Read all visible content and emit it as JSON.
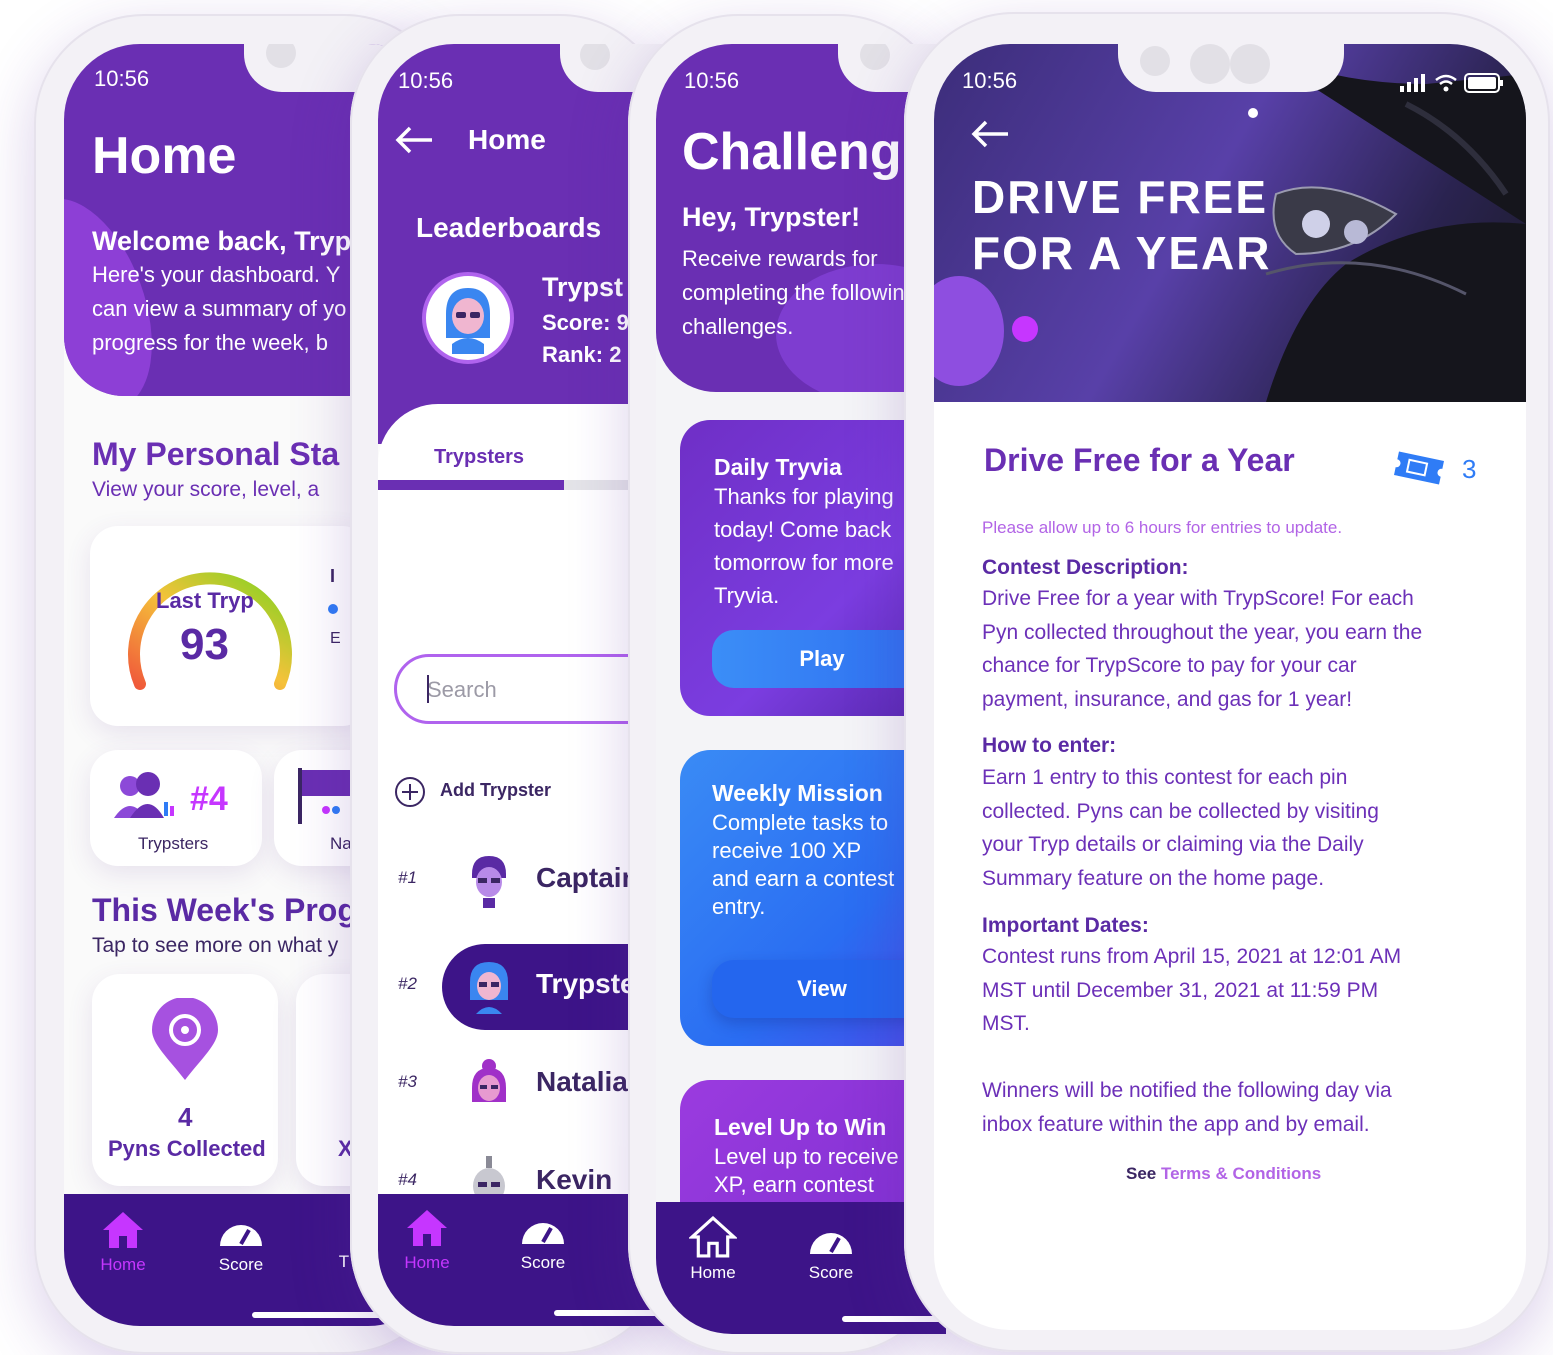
{
  "status": {
    "time": "10:56"
  },
  "home": {
    "title": "Home",
    "welcome": "Welcome back, Tryp",
    "intro_lines": [
      "Here's your dashboard. Y",
      "can view a summary of yo",
      "progress for the week, b"
    ],
    "stats_title": "My Personal Sta",
    "stats_sub": "View your score, level, a",
    "gauge": {
      "label": "Last Tryp",
      "value": "93"
    },
    "peek": [
      "I",
      "E"
    ],
    "rank_card": {
      "value": "#4",
      "label": "Trypsters"
    },
    "nat_card": {
      "label": "Na"
    },
    "progress_title": "This Week's Prog",
    "progress_sub": "Tap to see more on what y",
    "pyns": {
      "count": "4",
      "label": "Pyns Collected"
    },
    "peek_x": "X"
  },
  "leaderboard": {
    "nav_title": "Home",
    "title": "Leaderboards",
    "user": {
      "name": "Trypst",
      "score": "Score: 9",
      "rank": "Rank: 2"
    },
    "tab": "Trypsters",
    "search_placeholder": "Search",
    "add_label": "Add Trypster",
    "rows": [
      {
        "rank": "#1",
        "name": "Captain"
      },
      {
        "rank": "#2",
        "name": "Trypster"
      },
      {
        "rank": "#3",
        "name": "Natalia"
      },
      {
        "rank": "#4",
        "name": "Kevin"
      }
    ]
  },
  "challenges": {
    "title": "Challeng",
    "greeting": "Hey, Trypster!",
    "intro_lines": [
      "Receive rewards for",
      "completing the followin",
      "challenges."
    ],
    "cards": [
      {
        "title": "Daily Tryvia",
        "lines": [
          "Thanks for playing",
          "today! Come back",
          "tomorrow for more",
          "Tryvia."
        ],
        "button": "Play"
      },
      {
        "title": "Weekly Mission",
        "lines": [
          "Complete tasks to",
          "receive 100 XP",
          "and earn a contest",
          "entry."
        ],
        "button": "View"
      },
      {
        "title": "Level Up to Win",
        "lines": [
          "Level up to receive",
          "XP, earn contest"
        ]
      }
    ]
  },
  "tabs": {
    "home": "Home",
    "score": "Score",
    "peek": "T"
  },
  "contest": {
    "hero_line1": "DRIVE FREE",
    "hero_line2": "FOR A YEAR",
    "title": "Drive Free for a Year",
    "tickets": "3",
    "note": "Please allow up to 6 hours for entries to update.",
    "sections": [
      {
        "heading": "Contest Description:",
        "lines": [
          "Drive Free for a year with TrypScore! For each",
          "Pyn collected throughout the year, you earn the",
          "chance for TrypScore to pay for your car",
          "payment, insurance, and gas for 1 year!"
        ]
      },
      {
        "heading": "How to enter:",
        "lines": [
          "Earn 1 entry to this contest for each pin",
          "collected. Pyns can be collected by visiting",
          "your Tryp details or claiming via the Daily",
          "Summary feature on the home page."
        ]
      },
      {
        "heading": "Important Dates:",
        "lines": [
          "Contest runs from April 15, 2021 at 12:01 AM",
          "MST until December 31, 2021 at 11:59 PM",
          "MST."
        ]
      }
    ],
    "winners_lines": [
      "Winners will be notified the following day via",
      "inbox feature within the app and by email."
    ],
    "terms_prefix": "See ",
    "terms_link": "Terms & Conditions"
  },
  "colors": {
    "primary": "#6a2fb3",
    "dark": "#3d1488",
    "accent": "#c636ff",
    "blue": "#2f7cf6"
  }
}
